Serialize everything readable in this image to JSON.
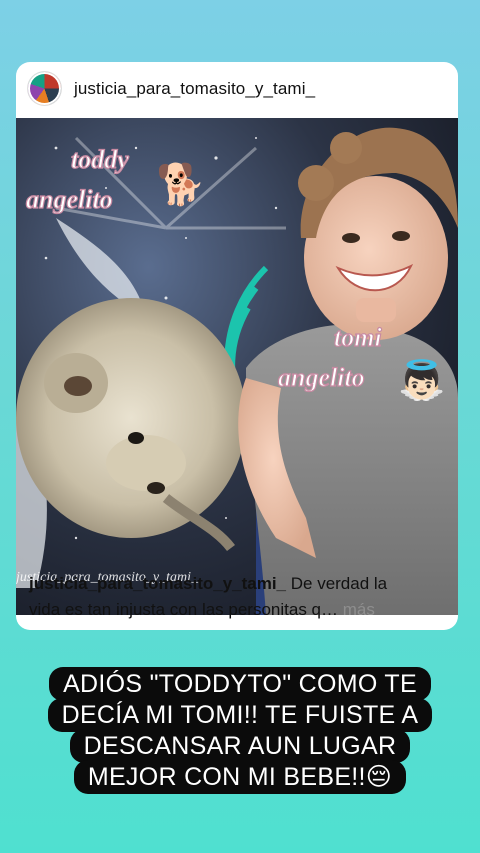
{
  "post": {
    "username": "justicia_para_tomasito_y_tami_",
    "photo": {
      "overlay_left_top": "toddy",
      "overlay_left_bottom": "angelito",
      "overlay_right_top": "tomi",
      "overlay_right_bottom": "angelito",
      "watermark": "justicia_para_tomasito_y_tami_",
      "dog_emoji": "🐕",
      "angel_emoji": "👼🏻"
    },
    "caption": {
      "username": "justicia_para_tomasito_y_tami_",
      "text_line1": " De verdad la",
      "text_line2": "vida es tan injusta con las personitas q…",
      "more": " más"
    }
  },
  "story": {
    "lines": [
      "ADIÓS \"TODDYTO\" COMO TE",
      "DECÍA MI TOMI!! TE FUISTE A",
      "DESCANSAR AUN LUGAR",
      "MEJOR CON MI BEBE!!😔"
    ]
  },
  "colors": {
    "background_top": "#7dd0e6",
    "background_bottom": "#4fe0d0",
    "card": "#ffffff",
    "story_text_bg": "#0b0b0b"
  }
}
